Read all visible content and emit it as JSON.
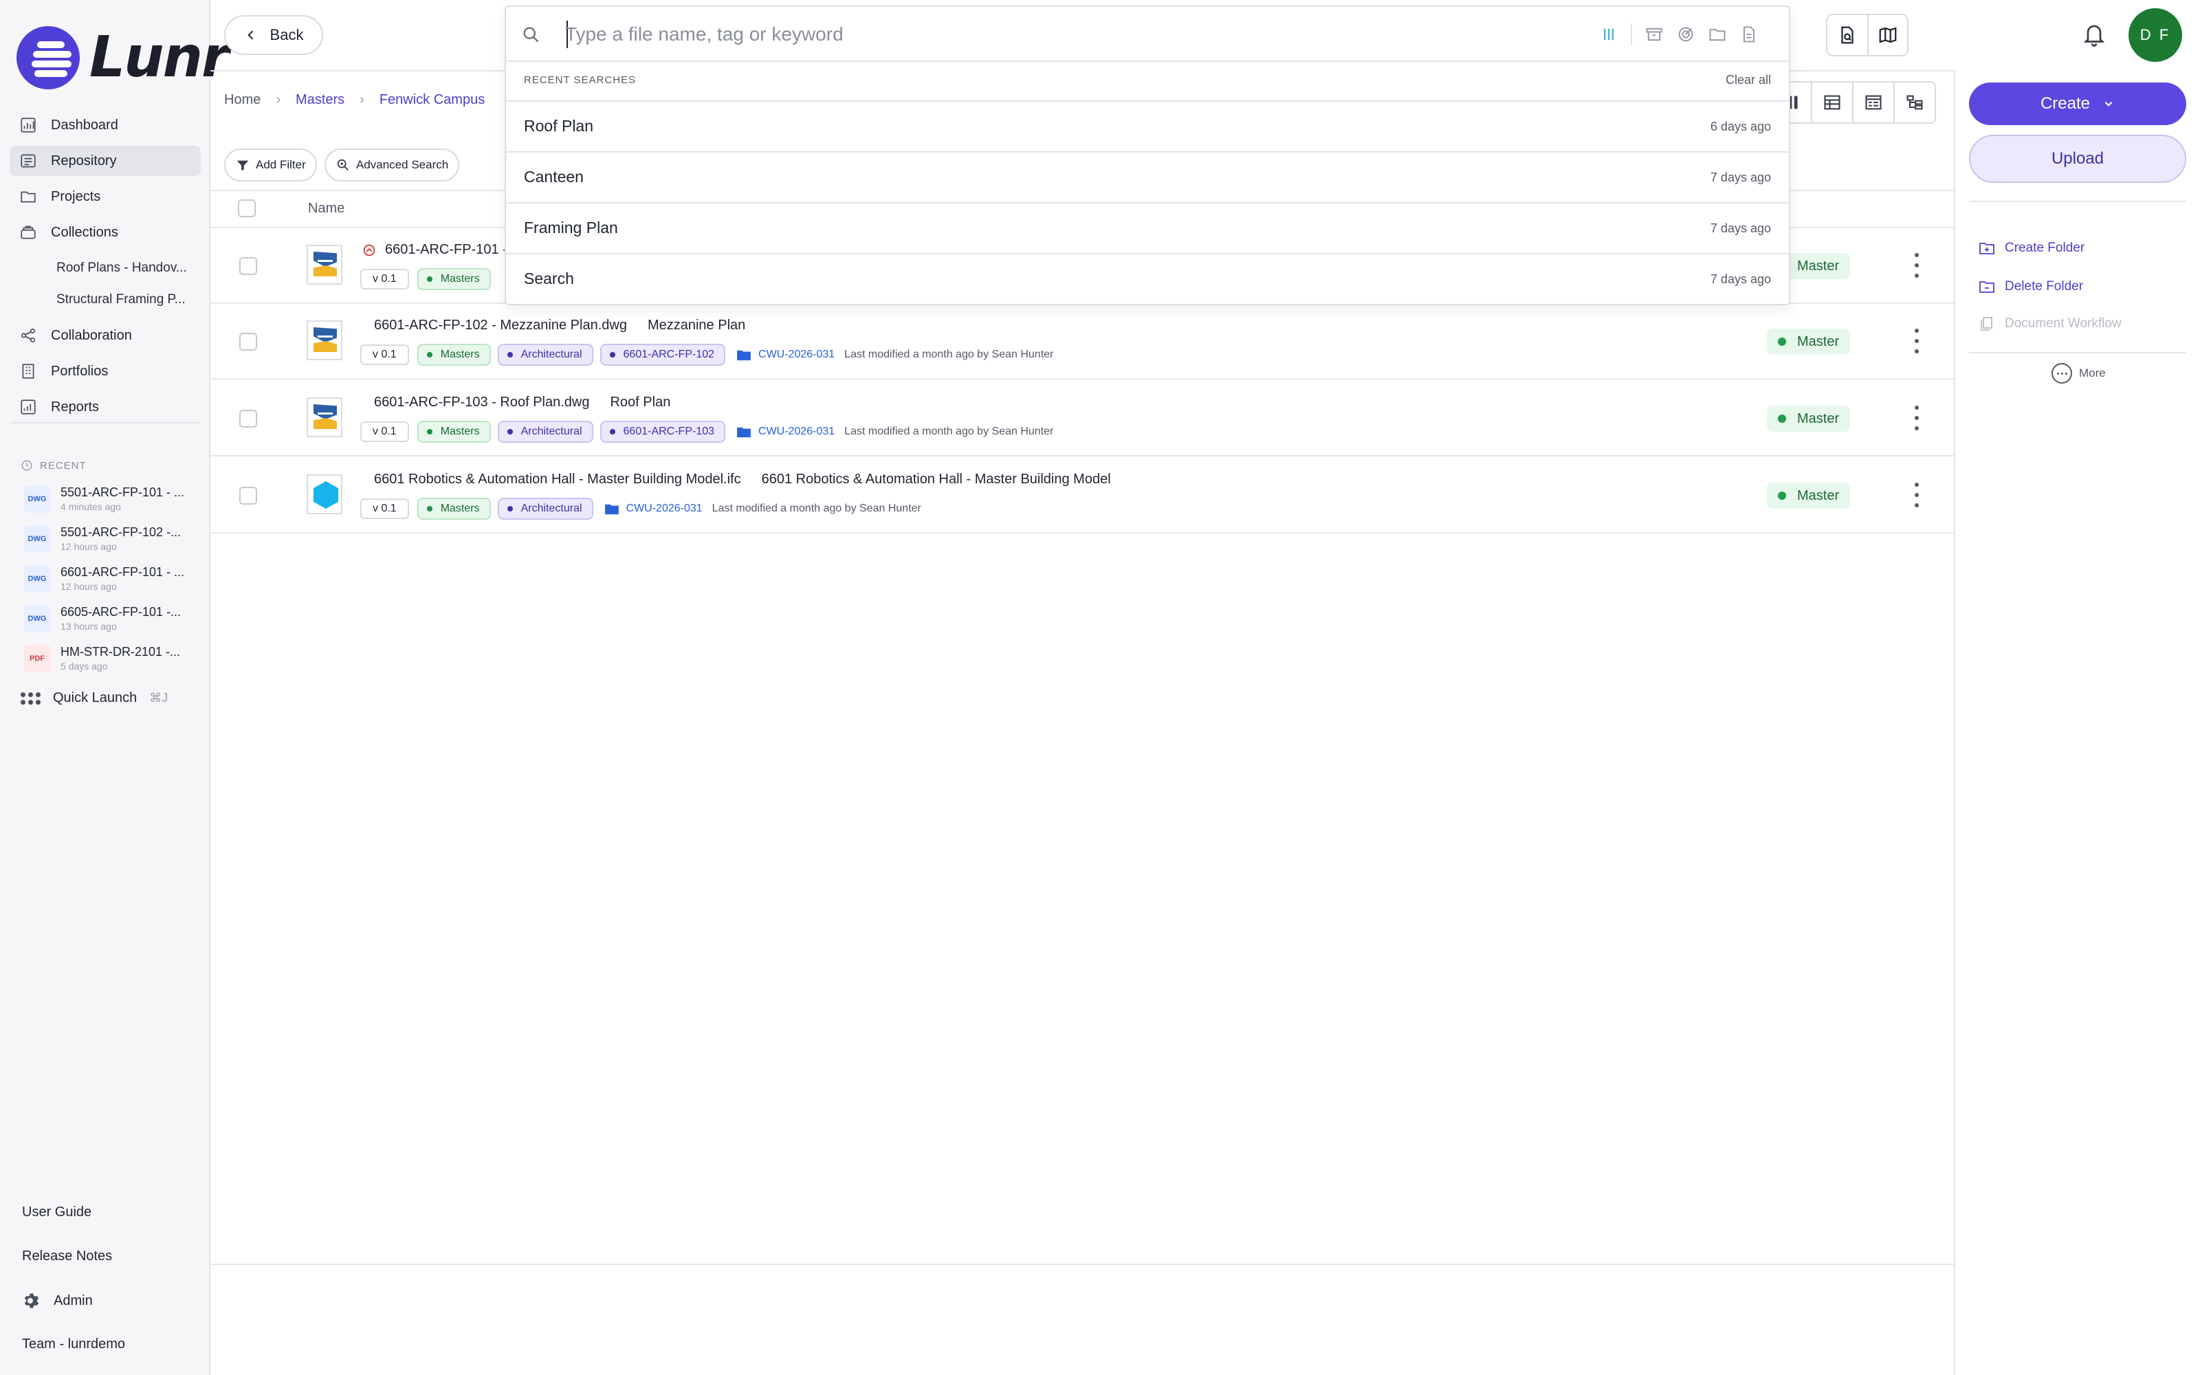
{
  "app": {
    "logo_text": "Lunr",
    "accent": "#5b48e0"
  },
  "sidebar": {
    "items": [
      {
        "label": "Dashboard",
        "icon": "chart-icon"
      },
      {
        "label": "Repository",
        "icon": "repository-icon",
        "active": true
      },
      {
        "label": "Projects",
        "icon": "folder-icon"
      },
      {
        "label": "Collections",
        "icon": "collections-icon"
      }
    ],
    "collections": [
      "Roof Plans - Handov...",
      "Structural Framing P..."
    ],
    "items2": [
      {
        "label": "Collaboration",
        "icon": "share-icon"
      },
      {
        "label": "Portfolios",
        "icon": "building-icon"
      },
      {
        "label": "Reports",
        "icon": "report-icon"
      }
    ],
    "recent_heading": "RECENT",
    "recent": [
      {
        "type": "DWG",
        "name": "5501-ARC-FP-101 - ...",
        "when": "4 minutes ago"
      },
      {
        "type": "DWG",
        "name": "5501-ARC-FP-102 -...",
        "when": "12 hours ago"
      },
      {
        "type": "DWG",
        "name": "6601-ARC-FP-101 - ...",
        "when": "12 hours ago"
      },
      {
        "type": "DWG",
        "name": "6605-ARC-FP-101 -...",
        "when": "13 hours ago"
      },
      {
        "type": "PDF",
        "name": "HM-STR-DR-2101 -...",
        "when": "5 days ago"
      }
    ],
    "quick_launch": {
      "label": "Quick Launch",
      "shortcut": "⌘J"
    },
    "footer": {
      "user_guide": "User Guide",
      "release_notes": "Release Notes",
      "admin": "Admin",
      "team": "Team - lunrdemo"
    }
  },
  "topbar": {
    "back_label": "Back",
    "avatar_initials": "D F"
  },
  "breadcrumb": [
    "Home",
    "Masters",
    "Fenwick Campus"
  ],
  "toolbar": {
    "add_filter": "Add Filter",
    "advanced_search": "Advanced Search"
  },
  "table": {
    "name_header": "Name",
    "rows": [
      {
        "file": "6601-ARC-FP-101 -",
        "title": "",
        "version": "v 0.1",
        "tags": [
          "Masters"
        ],
        "folder": "",
        "modified": "",
        "status": "Master",
        "thumb": "dwg",
        "synced": true
      },
      {
        "file": "6601-ARC-FP-102 - Mezzanine Plan.dwg",
        "title": "Mezzanine Plan",
        "version": "v 0.1",
        "tags": [
          "Masters",
          "Architectural",
          "6601-ARC-FP-102"
        ],
        "folder": "CWU-2026-031",
        "modified": "Last modified a month ago by Sean Hunter",
        "status": "Master",
        "thumb": "dwg"
      },
      {
        "file": "6601-ARC-FP-103 - Roof Plan.dwg",
        "title": "Roof Plan",
        "version": "v 0.1",
        "tags": [
          "Masters",
          "Architectural",
          "6601-ARC-FP-103"
        ],
        "folder": "CWU-2026-031",
        "modified": "Last modified a month ago by Sean Hunter",
        "status": "Master",
        "thumb": "dwg"
      },
      {
        "file": "6601 Robotics & Automation Hall - Master Building Model.ifc",
        "title": "6601 Robotics & Automation Hall - Master Building Model",
        "version": "v 0.1",
        "tags": [
          "Masters",
          "Architectural"
        ],
        "folder": "CWU-2026-031",
        "modified": "Last modified a month ago by Sean Hunter",
        "status": "Master",
        "thumb": "ifc"
      }
    ]
  },
  "right_panel": {
    "create": "Create",
    "upload": "Upload",
    "create_folder": "Create Folder",
    "delete_folder": "Delete Folder",
    "document_workflow": "Document Workflow",
    "more": "More"
  },
  "search": {
    "placeholder": "Type a file name, tag or keyword",
    "value": "",
    "recent_heading": "RECENT SEARCHES",
    "clear_all": "Clear all",
    "recent": [
      {
        "query": "Roof Plan",
        "when": "6 days ago"
      },
      {
        "query": "Canteen",
        "when": "7 days ago"
      },
      {
        "query": "Framing Plan",
        "when": "7 days ago"
      },
      {
        "query": "Search",
        "when": "7 days ago"
      }
    ]
  }
}
